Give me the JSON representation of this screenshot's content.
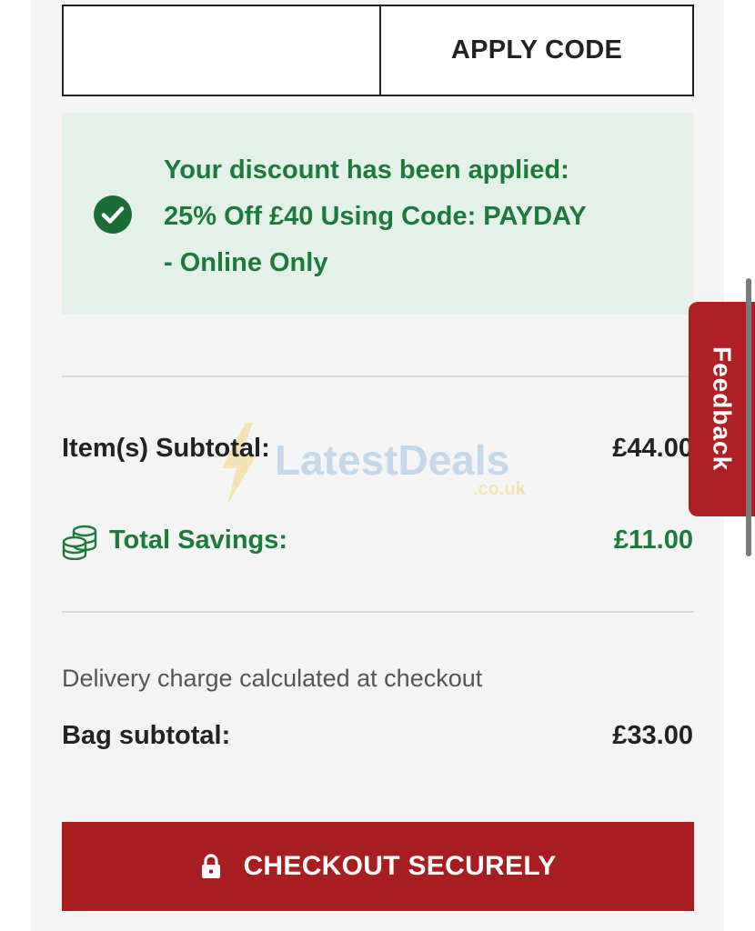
{
  "promo": {
    "input_value": "",
    "apply_label": "APPLY CODE"
  },
  "discount": {
    "line1": "Your discount has been applied:",
    "line2": "25% Off £40 Using Code: PAYDAY",
    "line3": "- Online Only",
    "icon": "check-circle-icon",
    "color": "#1d7a3c"
  },
  "summary": {
    "items_subtotal_label": "Item(s) Subtotal:",
    "items_subtotal_value": "£44.00",
    "total_savings_label": "Total Savings:",
    "total_savings_value": "£11.00",
    "delivery_note": "Delivery charge calculated at checkout",
    "bag_subtotal_label": "Bag subtotal:",
    "bag_subtotal_value": "£33.00"
  },
  "checkout": {
    "label": "CHECKOUT SECURELY",
    "icon": "lock-icon",
    "color": "#a81d1f"
  },
  "feedback": {
    "label": "Feedback"
  },
  "watermark": {
    "main": "LatestDeals",
    "sub": ".co.uk"
  }
}
